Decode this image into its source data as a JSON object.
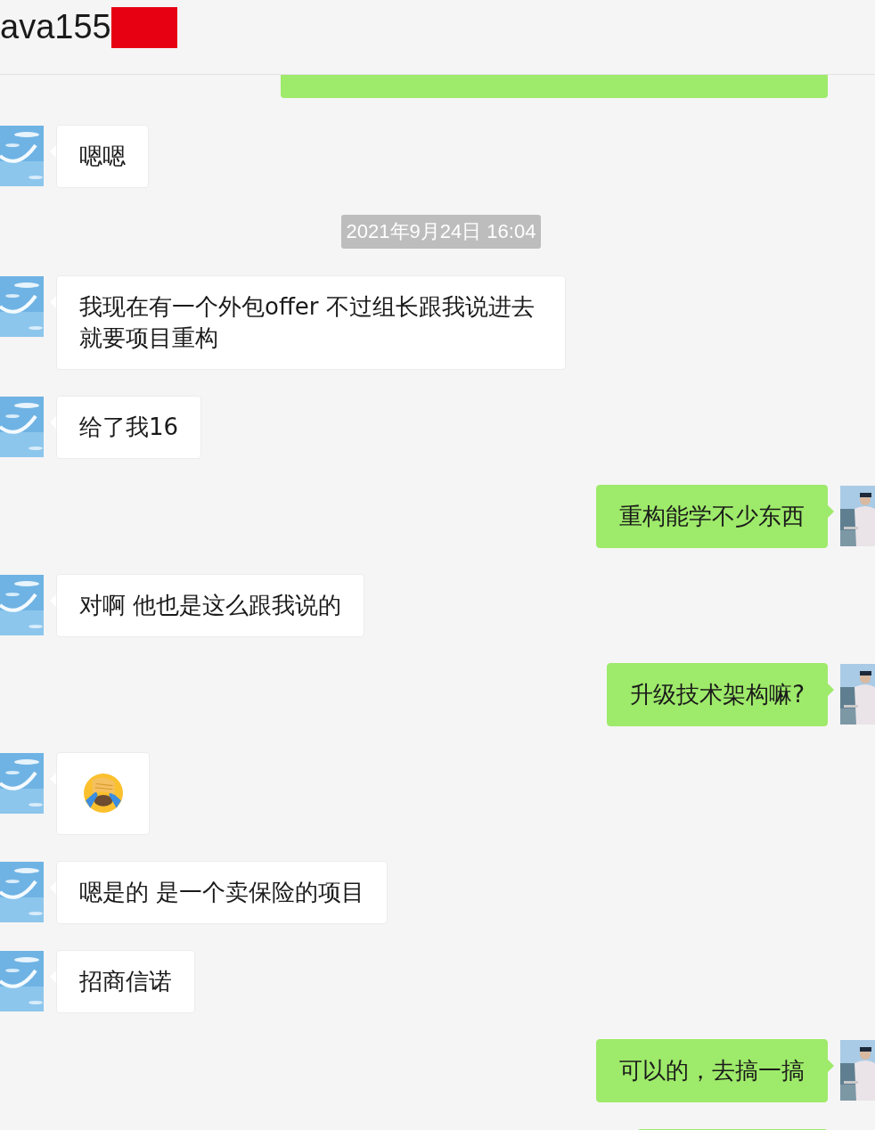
{
  "window": {
    "title": "ava155"
  },
  "messages": [
    {
      "kind": "partial",
      "outgoing": true
    },
    {
      "kind": "text",
      "outgoing": false,
      "text": "嗯嗯"
    },
    {
      "kind": "time",
      "text": "2021年9月24日 16:04"
    },
    {
      "kind": "text",
      "outgoing": false,
      "text": "我现在有一个外包offer 不过组长跟我说进去就要项目重构"
    },
    {
      "kind": "text",
      "outgoing": false,
      "text": "给了我16"
    },
    {
      "kind": "text",
      "outgoing": true,
      "text": "重构能学不少东西"
    },
    {
      "kind": "text",
      "outgoing": false,
      "text": "对啊 他也是这么跟我说的"
    },
    {
      "kind": "text",
      "outgoing": true,
      "text": "升级技术架构嘛?"
    },
    {
      "kind": "emoji",
      "outgoing": false
    },
    {
      "kind": "text",
      "outgoing": false,
      "text": "嗯是的 是一个卖保险的项目"
    },
    {
      "kind": "text",
      "outgoing": false,
      "text": "招商信诺"
    },
    {
      "kind": "text",
      "outgoing": true,
      "text": "可以的，去搞一搞"
    },
    {
      "kind": "partial",
      "outgoing": true
    }
  ]
}
